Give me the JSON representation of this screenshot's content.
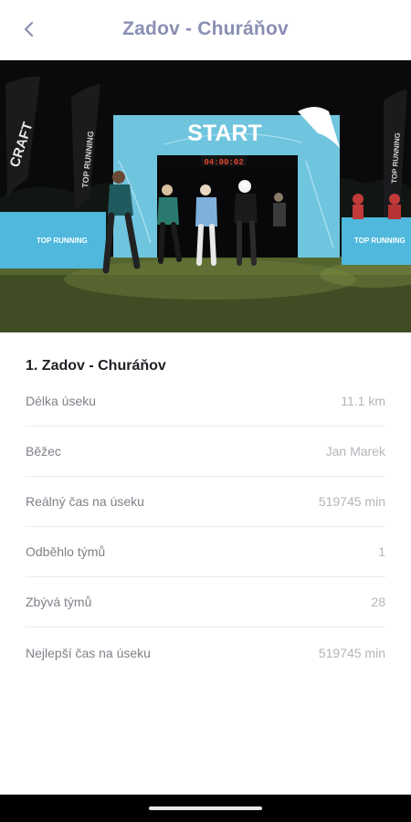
{
  "header": {
    "title": "Zadov - Churáňov",
    "back_icon": "chevron-left-icon"
  },
  "hero": {
    "arch_text": "START",
    "clock_text": "04:00:02",
    "left_flag_text": "CRAFT",
    "flag_text": "TOP RUNNING",
    "banner_text": "TOP RUNNING",
    "colors": {
      "arch": "#6fc4de",
      "banner": "#4fb8dc",
      "night": "#0a0a0c",
      "grass": "#4a5a2c"
    }
  },
  "section": {
    "title": "1. Zadov - Churáňov"
  },
  "rows": [
    {
      "label": "Délka úseku",
      "value": "11.1 km"
    },
    {
      "label": "Běžec",
      "value": "Jan Marek"
    },
    {
      "label": "Reálný čas na úseku",
      "value": "519745 min"
    },
    {
      "label": "Odběhlo týmů",
      "value": "1"
    },
    {
      "label": "Zbývá týmů",
      "value": "28"
    },
    {
      "label": "Nejlepší čas na úseku",
      "value": "519745 min"
    }
  ]
}
